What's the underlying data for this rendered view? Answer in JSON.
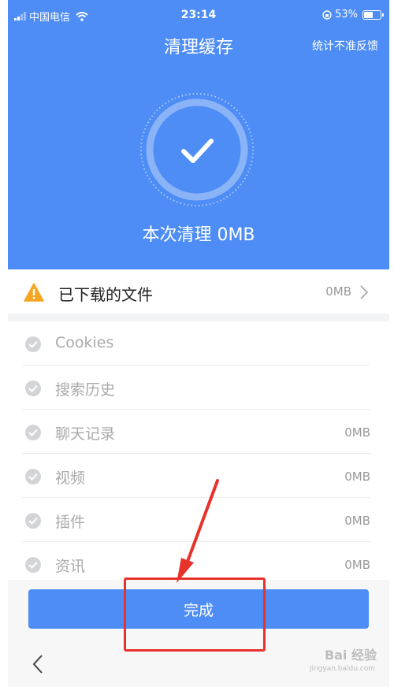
{
  "status_bar": {
    "carrier": "中国电信",
    "time": "23:14",
    "battery": "53%",
    "battery_level": 0.53
  },
  "header": {
    "title": "清理缓存",
    "action_label": "统计不准反馈"
  },
  "result": {
    "text": "本次清理 0MB"
  },
  "downloads": {
    "label": "已下载的文件",
    "size": "0MB"
  },
  "list": {
    "items": [
      {
        "label": "Cookies",
        "value": ""
      },
      {
        "label": "搜索历史",
        "value": ""
      },
      {
        "label": "聊天记录",
        "value": "0MB"
      },
      {
        "label": "视频",
        "value": "0MB"
      },
      {
        "label": "插件",
        "value": "0MB"
      },
      {
        "label": "资讯",
        "value": "0MB"
      }
    ]
  },
  "done_button": {
    "label": "完成"
  },
  "watermark": {
    "text": "Bai 经验",
    "sub": "jingyan.baidu.com"
  },
  "colors": {
    "primary": "#4d8df5",
    "warning": "#f5a623",
    "annotation": "#e8322c"
  },
  "icons": {
    "check": "check-icon",
    "warning": "warning-icon",
    "chevron": "chevron-right-icon",
    "back": "back-icon",
    "wifi": "wifi-icon"
  }
}
